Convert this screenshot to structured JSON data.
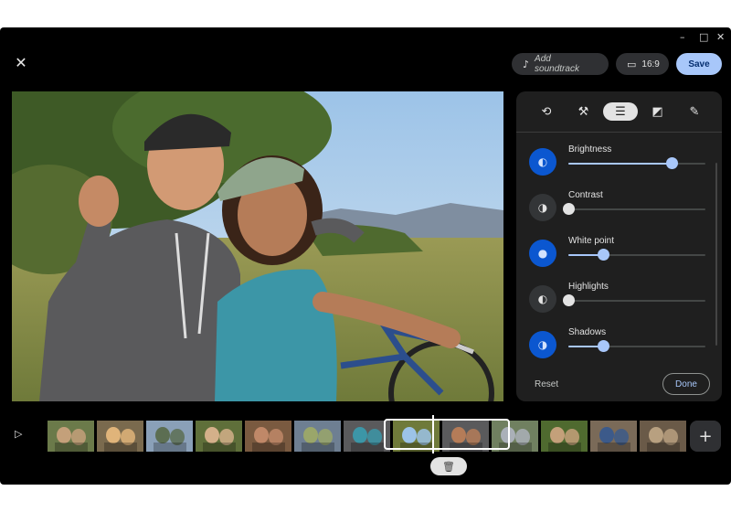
{
  "window_controls": {
    "minimize": "–",
    "maximize": "□",
    "close": "✕"
  },
  "toolbar": {
    "close_icon": "close-icon",
    "soundtrack_label": "Add soundtrack",
    "soundtrack_icon": "music-note-icon",
    "aspect_label": "16:9",
    "aspect_icon": "aspect-ratio-icon",
    "save_label": "Save"
  },
  "tools": [
    {
      "icon": "rotate-icon",
      "glyph": "⟲",
      "active": false
    },
    {
      "icon": "tools-icon",
      "glyph": "⚒",
      "active": false
    },
    {
      "icon": "adjust-sliders-icon",
      "glyph": "☰",
      "active": true
    },
    {
      "icon": "filter-icon",
      "glyph": "◩",
      "active": false
    },
    {
      "icon": "markup-icon",
      "glyph": "✎",
      "active": false
    }
  ],
  "adjustments": [
    {
      "label": "Brightness",
      "value": 0.75,
      "active": true,
      "glyph": "◐"
    },
    {
      "label": "Contrast",
      "value": 0.0,
      "active": false,
      "glyph": "◑"
    },
    {
      "label": "White point",
      "value": 0.25,
      "active": true,
      "glyph": "●"
    },
    {
      "label": "Highlights",
      "value": 0.0,
      "active": false,
      "glyph": "◐"
    },
    {
      "label": "Shadows",
      "value": 0.25,
      "active": true,
      "glyph": "◑"
    }
  ],
  "panel": {
    "reset_label": "Reset",
    "done_label": "Done"
  },
  "timeline": {
    "play_glyph": "▷",
    "add_glyph": "+",
    "trash_glyph": "🗑"
  },
  "colors": {
    "accent": "#a8c7fa",
    "active_circle": "#0b57d0",
    "panel_bg": "#1f1f1f",
    "window_bg": "#000000"
  }
}
